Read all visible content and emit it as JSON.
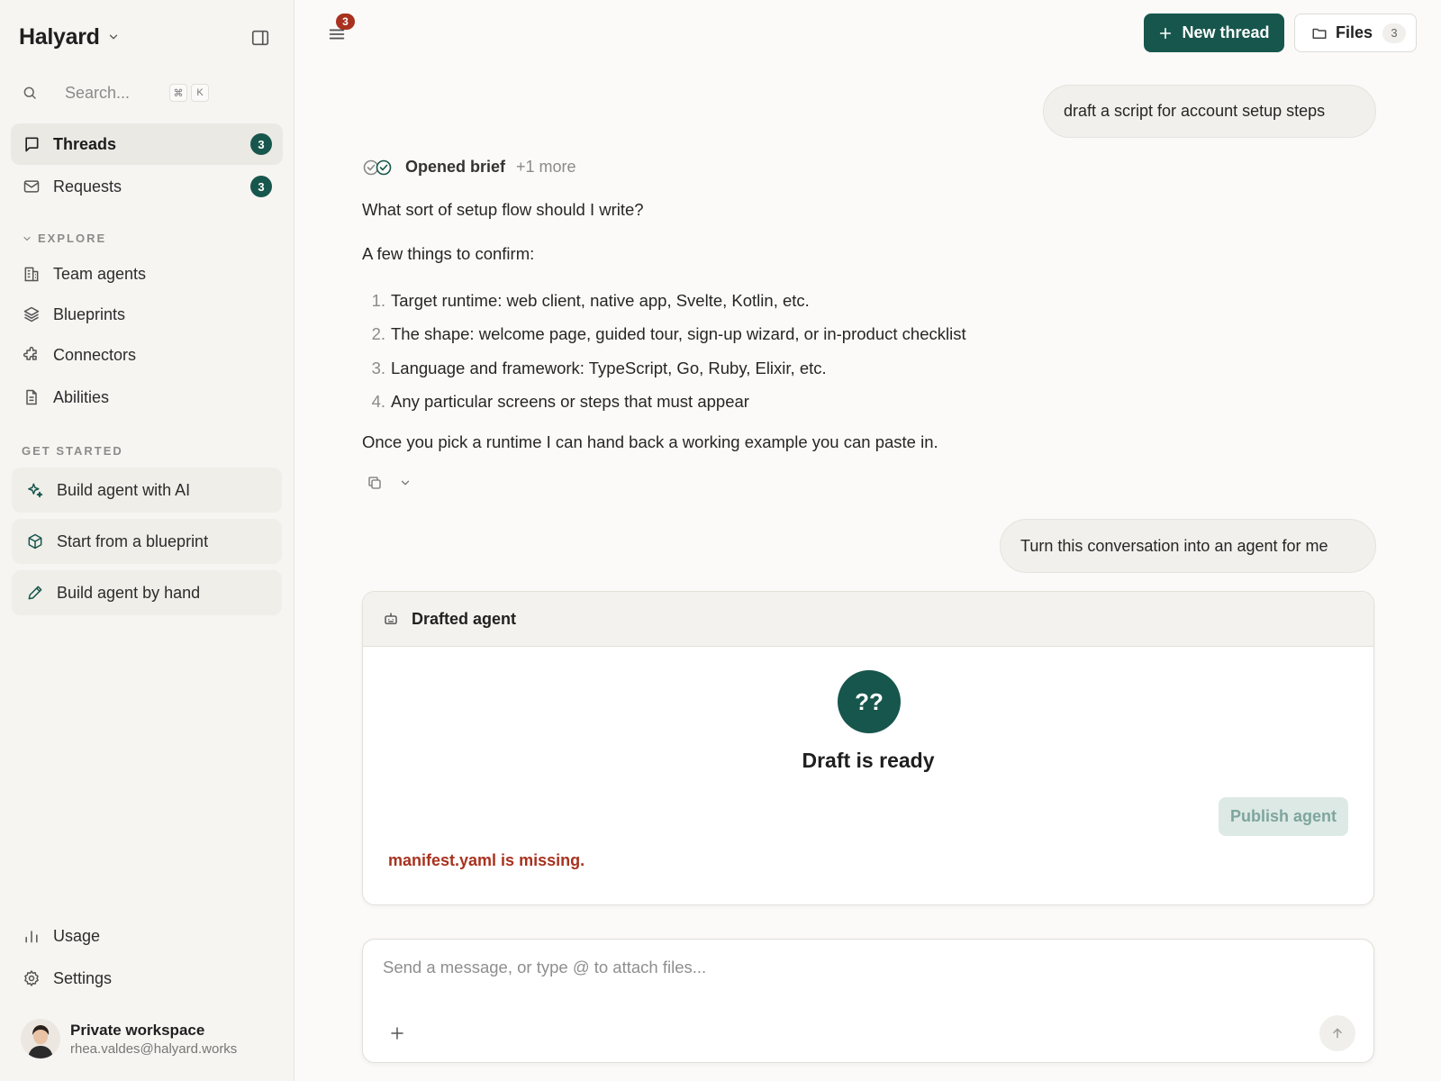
{
  "app": {
    "name": "Halyard"
  },
  "search": {
    "placeholder": "Search...",
    "shortcut_mod": "⌘",
    "shortcut_key": "K"
  },
  "nav": {
    "threads": {
      "label": "Threads",
      "badge": "3"
    },
    "requests": {
      "label": "Requests",
      "badge": "3"
    }
  },
  "explore": {
    "heading": "EXPLORE",
    "items": [
      {
        "label": "Team agents",
        "icon": "building-icon"
      },
      {
        "label": "Blueprints",
        "icon": "layers-icon"
      },
      {
        "label": "Connectors",
        "icon": "puzzle-icon"
      },
      {
        "label": "Abilities",
        "icon": "document-icon"
      }
    ]
  },
  "get_started": {
    "heading": "GET STARTED",
    "items": [
      {
        "label": "Build agent with AI",
        "icon": "sparkles-icon"
      },
      {
        "label": "Start from a blueprint",
        "icon": "cube-icon"
      },
      {
        "label": "Build agent by hand",
        "icon": "pencil-icon"
      }
    ]
  },
  "footer": {
    "usage": "Usage",
    "settings": "Settings"
  },
  "user": {
    "name": "Private workspace",
    "email": "rhea.valdes@halyard.works"
  },
  "topbar": {
    "menu_badge": "3",
    "new_thread": "New thread",
    "files": "Files",
    "files_count": "3"
  },
  "conversation": {
    "user_message_1": "draft a script for account setup steps",
    "tool_label": "Opened brief",
    "tool_more": "+1 more",
    "assistant": {
      "question": "What sort of setup flow should I write?",
      "intro": "A few things to confirm:",
      "items": [
        {
          "num": "1.",
          "text": "Target runtime: web client, native app, Svelte, Kotlin, etc."
        },
        {
          "num": "2.",
          "text": "The shape: welcome page, guided tour, sign-up wizard, or in-product checklist"
        },
        {
          "num": "3.",
          "text": "Language and framework: TypeScript, Go, Ruby, Elixir, etc."
        },
        {
          "num": "4.",
          "text": "Any particular screens or steps that must appear"
        }
      ],
      "closing": "Once you pick a runtime I can hand back a working example you can paste in."
    },
    "user_message_2": "Turn this conversation into an agent for me"
  },
  "agent_card": {
    "title": "Drafted agent",
    "avatar_text": "??",
    "status": "Draft is ready",
    "publish": "Publish agent",
    "error": "manifest.yaml is missing."
  },
  "composer": {
    "placeholder": "Send a message, or type @ to attach files..."
  },
  "colors": {
    "accent": "#17564c",
    "error": "#a8321f",
    "sidebar_bg": "#f6f5f2",
    "page_bg": "#fbfaf8"
  }
}
